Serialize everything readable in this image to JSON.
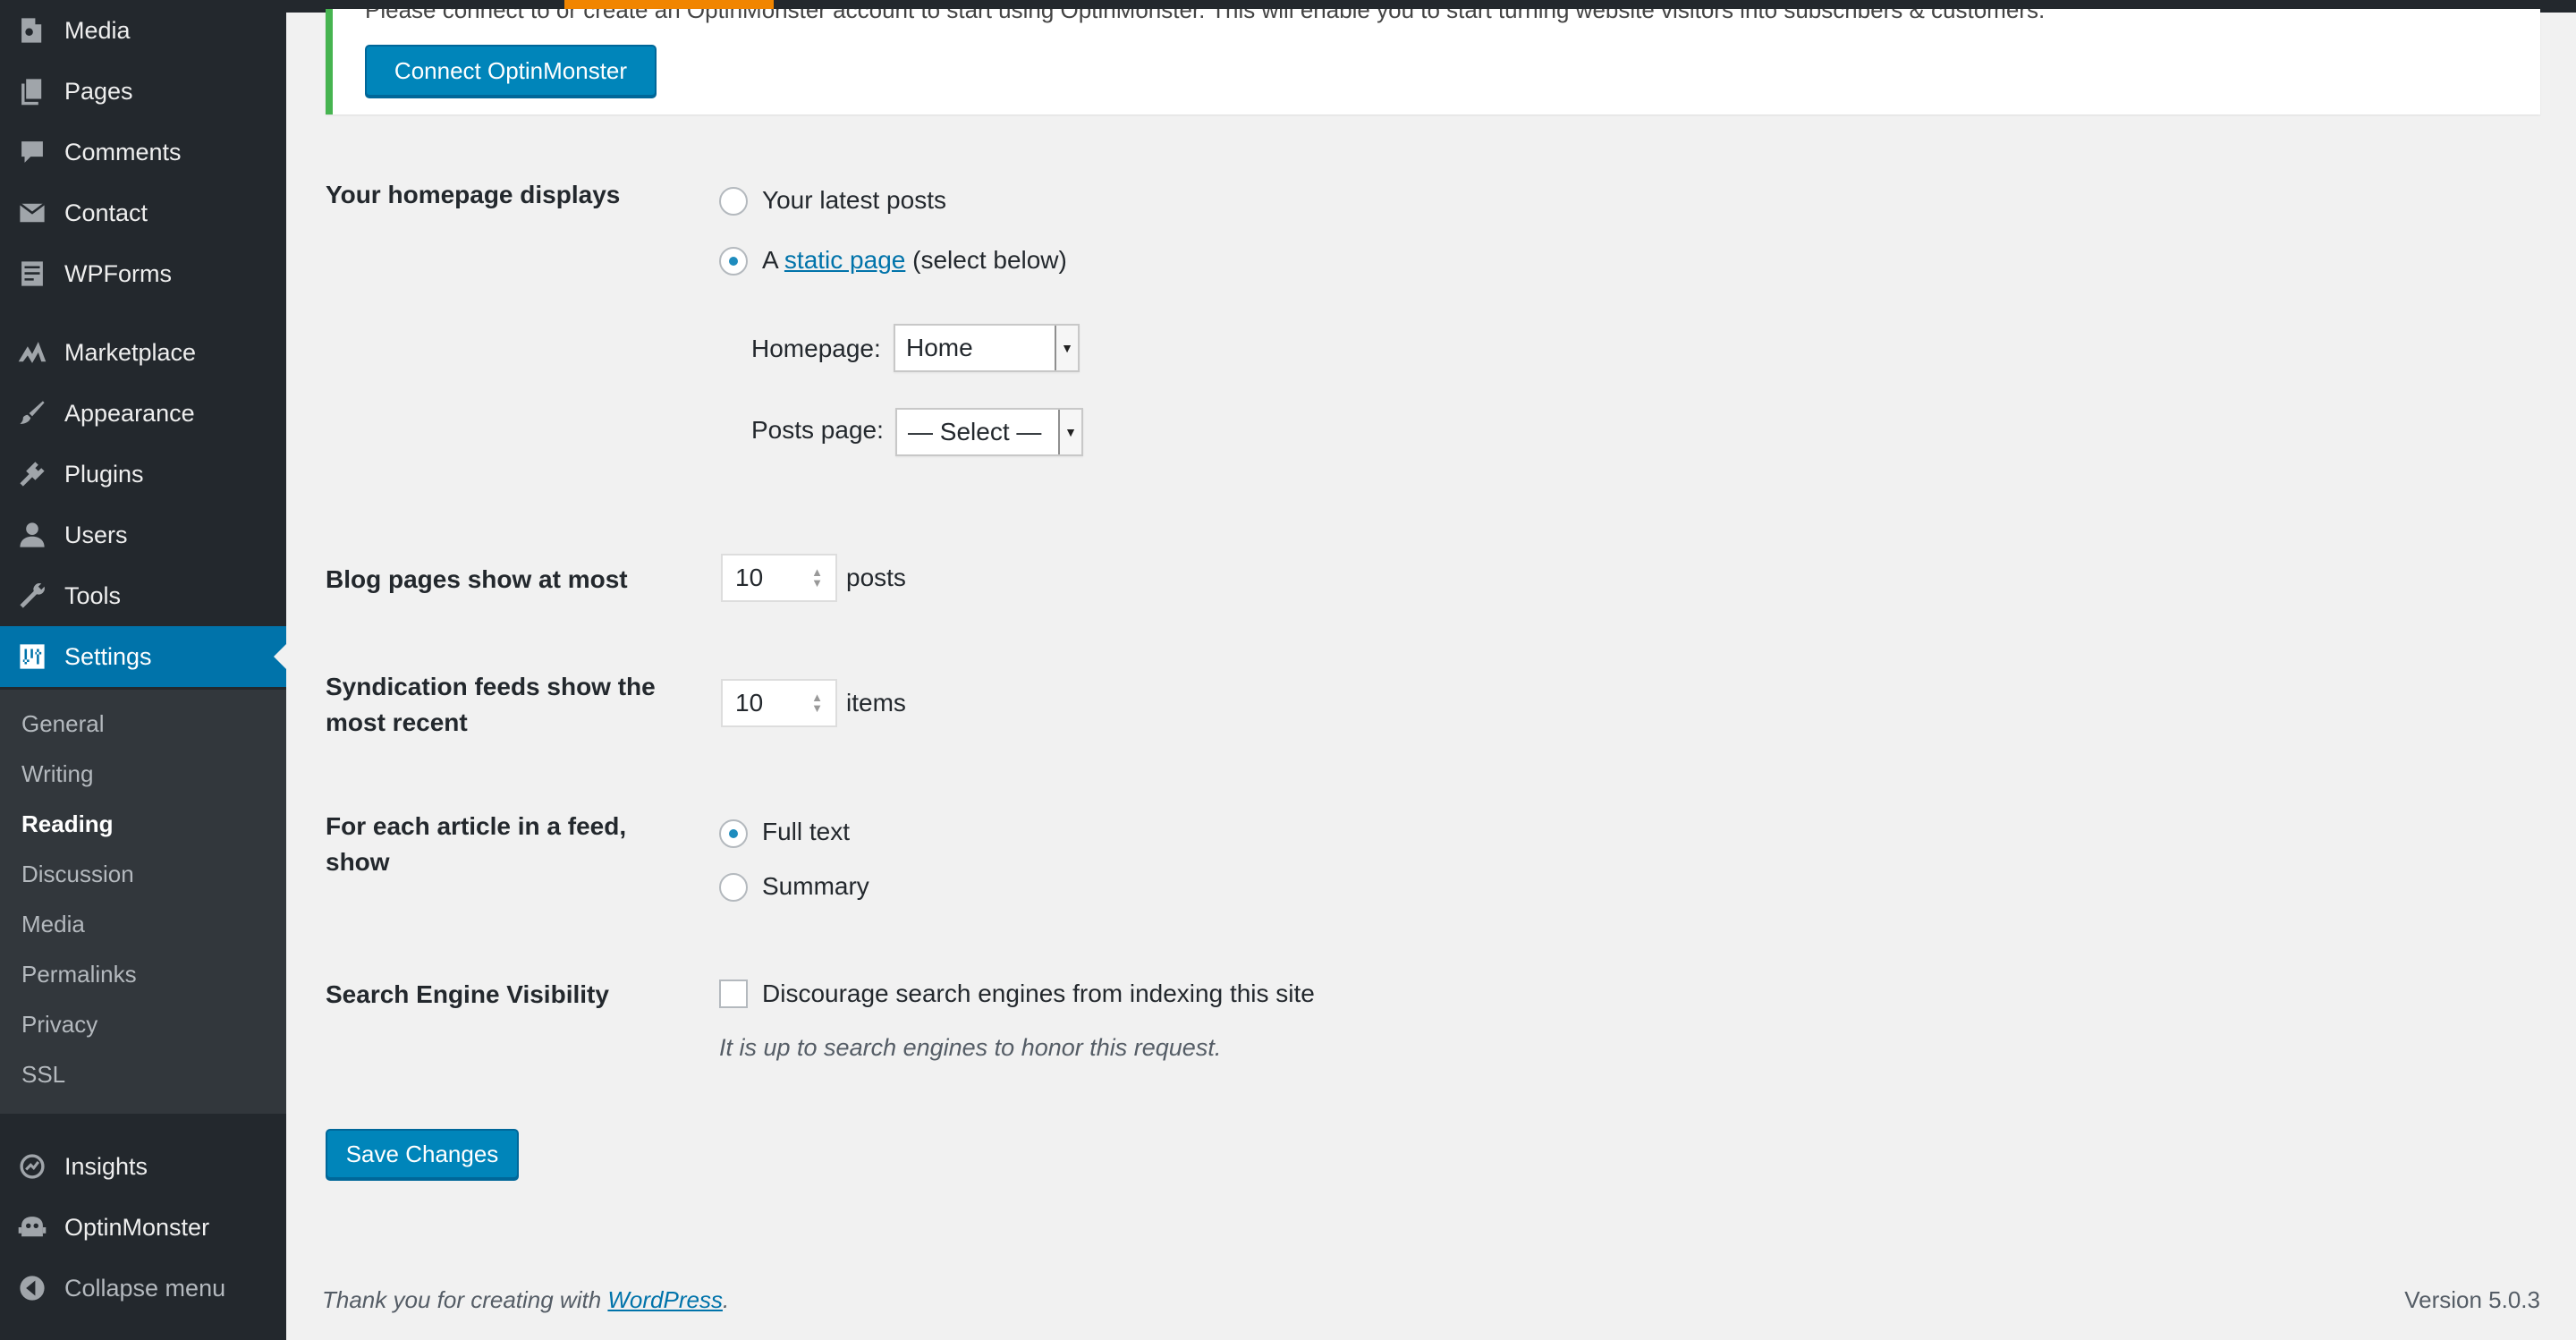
{
  "sidebar": {
    "items_top": [
      {
        "label": "Media",
        "icon": "media-icon"
      },
      {
        "label": "Pages",
        "icon": "pages-icon"
      },
      {
        "label": "Comments",
        "icon": "comments-icon"
      },
      {
        "label": "Contact",
        "icon": "envelope-icon"
      },
      {
        "label": "WPForms",
        "icon": "wpforms-icon"
      },
      {
        "label": "Marketplace",
        "icon": "marketplace-icon"
      },
      {
        "label": "Appearance",
        "icon": "paintbrush-icon"
      },
      {
        "label": "Plugins",
        "icon": "plugin-icon"
      },
      {
        "label": "Users",
        "icon": "user-icon"
      },
      {
        "label": "Tools",
        "icon": "wrench-icon"
      },
      {
        "label": "Settings",
        "icon": "settings-icon"
      }
    ],
    "submenu": [
      "General",
      "Writing",
      "Reading",
      "Discussion",
      "Media",
      "Permalinks",
      "Privacy",
      "SSL"
    ],
    "active_submenu": "Reading",
    "items_bottom": [
      {
        "label": "Insights",
        "icon": "insights-icon"
      },
      {
        "label": "OptinMonster",
        "icon": "optinmonster-icon"
      },
      {
        "label": "Collapse menu",
        "icon": "collapse-icon"
      }
    ]
  },
  "notice": {
    "text": "Please connect to or create an OptinMonster account to start using OptinMonster. This will enable you to start turning website visitors into subscribers & customers.",
    "button": "Connect OptinMonster"
  },
  "form": {
    "homepage_displays": {
      "label": "Your homepage displays",
      "option_latest": "Your latest posts",
      "option_static_prefix": "A",
      "option_static_link": "static page",
      "option_static_suffix": "(select below)",
      "homepage_label": "Homepage:",
      "homepage_value": "Home",
      "posts_page_label": "Posts page:",
      "posts_page_value": "— Select —"
    },
    "blog_pages": {
      "label": "Blog pages show at most",
      "value": "10",
      "unit": "posts"
    },
    "syndication": {
      "label_line1": "Syndication feeds show the",
      "label_line2": "most recent",
      "value": "10",
      "unit": "items"
    },
    "feed_article": {
      "label_line1": "For each article in a feed,",
      "label_line2": "show",
      "option_full": "Full text",
      "option_summary": "Summary"
    },
    "search_visibility": {
      "label": "Search Engine Visibility",
      "checkbox_label": "Discourage search engines from indexing this site",
      "description": "It is up to search engines to honor this request."
    },
    "save_button": "Save Changes"
  },
  "footer": {
    "thanks_prefix": "Thank you for creating with",
    "thanks_link": "WordPress",
    "thanks_suffix": ".",
    "version": "Version 5.0.3"
  },
  "colors": {
    "sidebar_bg": "#23282d",
    "submenu_bg": "#32373c",
    "accent": "#0073aa",
    "button": "#0085ba",
    "notice_border": "#46b450",
    "topbar_accent": "#f18500"
  }
}
